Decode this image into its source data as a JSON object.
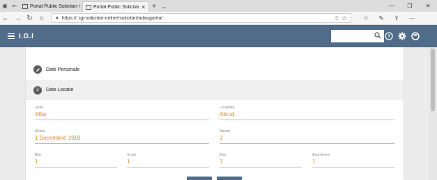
{
  "browser": {
    "tabs": [
      {
        "title": "Portal Public Solicitari Onlin",
        "active": false
      },
      {
        "title": "Portal Public Solicitari C",
        "active": true
      }
    ],
    "url": "https://                    :igi-solicitari-online/solicitari/adauga/ea/",
    "icons": {
      "back": "back-arrow-icon",
      "forward": "forward-arrow-icon",
      "refresh": "refresh-icon",
      "home": "home-icon",
      "lock": "lock-icon",
      "reader": "reader-view-icon",
      "favorite": "star-icon",
      "favorites_bar": "favorites-icon",
      "pen": "pen-icon",
      "share": "share-icon",
      "more": "more-icon"
    }
  },
  "app": {
    "title": "I.G.I",
    "search_placeholder": "",
    "accent_color": "#506c88"
  },
  "steps": [
    {
      "label": "Date Personale",
      "icon": "edit-icon"
    },
    {
      "label": "Date Locatie",
      "number": "2"
    }
  ],
  "form": {
    "judet": {
      "label": "Judet",
      "value": "Alba"
    },
    "localitate": {
      "label": "Localitate",
      "value": "Abrud"
    },
    "strada": {
      "label": "Strada",
      "value": "1 Decembrie 1918"
    },
    "numar": {
      "label": "Numar",
      "value": "1"
    },
    "bloc": {
      "label": "Bloc",
      "value": "1"
    },
    "scara": {
      "label": "Scara",
      "value": "1"
    },
    "etaj": {
      "label": "Etaj",
      "value": "1"
    },
    "apartament": {
      "label": "Apartament",
      "value": "1"
    }
  },
  "value_color": "#e8891f"
}
